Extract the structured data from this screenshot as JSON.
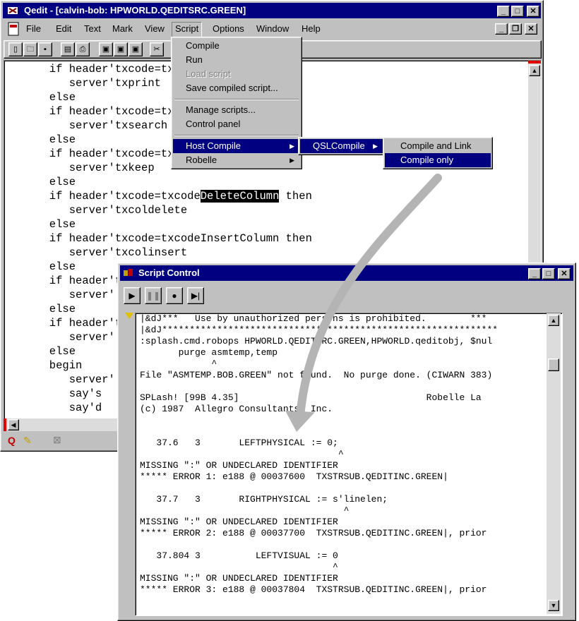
{
  "qedit": {
    "title": "Qedit - [calvin-bob: HPWORLD.QEDITSRC.GREEN]",
    "menu": [
      "File",
      "Edit",
      "Text",
      "Mark",
      "View",
      "Script",
      "Options",
      "Window",
      "Help"
    ],
    "code_lines": [
      "      if header'txcode=txcodePrintScreen",
      "         server'txprint",
      "      else",
      "      if header'txcode=txcodeSearch then",
      "         server'txsearch",
      "      else",
      "      if header'txcode=txcodeKeep then",
      "         server'txkeep",
      "      else",
      "      if header'txcode=txcodeDeleteColumn then",
      "         server'txcoldelete",
      "      else",
      "      if header'txcode=txcodeInsertColumn then",
      "         server'txcolinsert",
      "      else",
      "      if header'txcode=",
      "         server'",
      "      else",
      "      if header'txcode=",
      "         server'",
      "      else",
      "      begin",
      "         server'",
      "         say's",
      "         say'd"
    ],
    "highlight": "DeleteColumn"
  },
  "script_menu": {
    "items": [
      {
        "label": "Compile",
        "disabled": false
      },
      {
        "label": "Run",
        "disabled": false
      },
      {
        "label": "Load script",
        "disabled": true
      },
      {
        "label": "Save compiled script...",
        "disabled": false
      },
      {
        "label": "Manage scripts...",
        "disabled": false
      },
      {
        "label": "Control panel",
        "disabled": false
      },
      {
        "label": "Host Compile",
        "disabled": false,
        "submenu": true,
        "selected": true
      },
      {
        "label": "Robelle",
        "disabled": false,
        "submenu": true
      }
    ]
  },
  "host_compile_menu": {
    "items": [
      {
        "label": "QSLCompile",
        "submenu": true,
        "selected": true
      }
    ]
  },
  "qsl_menu": {
    "items": [
      {
        "label": "Compile and Link",
        "selected": false
      },
      {
        "label": "Compile only",
        "selected": true
      }
    ]
  },
  "script_control": {
    "title": "Script Control",
    "output_lines": [
      "|&dJ***   Use by unauthorized persons is prohibited.        ***",
      "|&dJ*************************************************************",
      ":splash.cmd.robops HPWORLD.QEDITSRC.GREEN,HPWORLD.qeditobj, $nul",
      "       purge asmtemp,temp",
      "             ^",
      "File \"ASMTEMP.BOB.GREEN\" not found.  No purge done. (CIWARN 383)",
      "",
      "SPLash! [99B 4.35]                                  Robelle La",
      "(c) 1987  Allegro Consultants, Inc.",
      "",
      "",
      "   37.6   3       LEFTPHYSICAL := 0;",
      "                                    ^",
      "MISSING \":\" OR UNDECLARED IDENTIFIER",
      "***** ERROR 1: e188 @ 00037600  TXSTRSUB.QEDITINC.GREEN|",
      "",
      "   37.7   3       RIGHTPHYSICAL := s'linelen;",
      "                                     ^",
      "MISSING \":\" OR UNDECLARED IDENTIFIER",
      "***** ERROR 2: e188 @ 00037700  TXSTRSUB.QEDITINC.GREEN|, prior",
      "",
      "   37.804 3          LEFTVISUAL := 0",
      "                                   ^",
      "MISSING \":\" OR UNDECLARED IDENTIFIER",
      "***** ERROR 3: e188 @ 00037804  TXSTRSUB.QEDITINC.GREEN|, prior"
    ]
  },
  "colors": {
    "titlebar": "#000080",
    "face": "#c0c0c0",
    "highlight": "#000080"
  }
}
